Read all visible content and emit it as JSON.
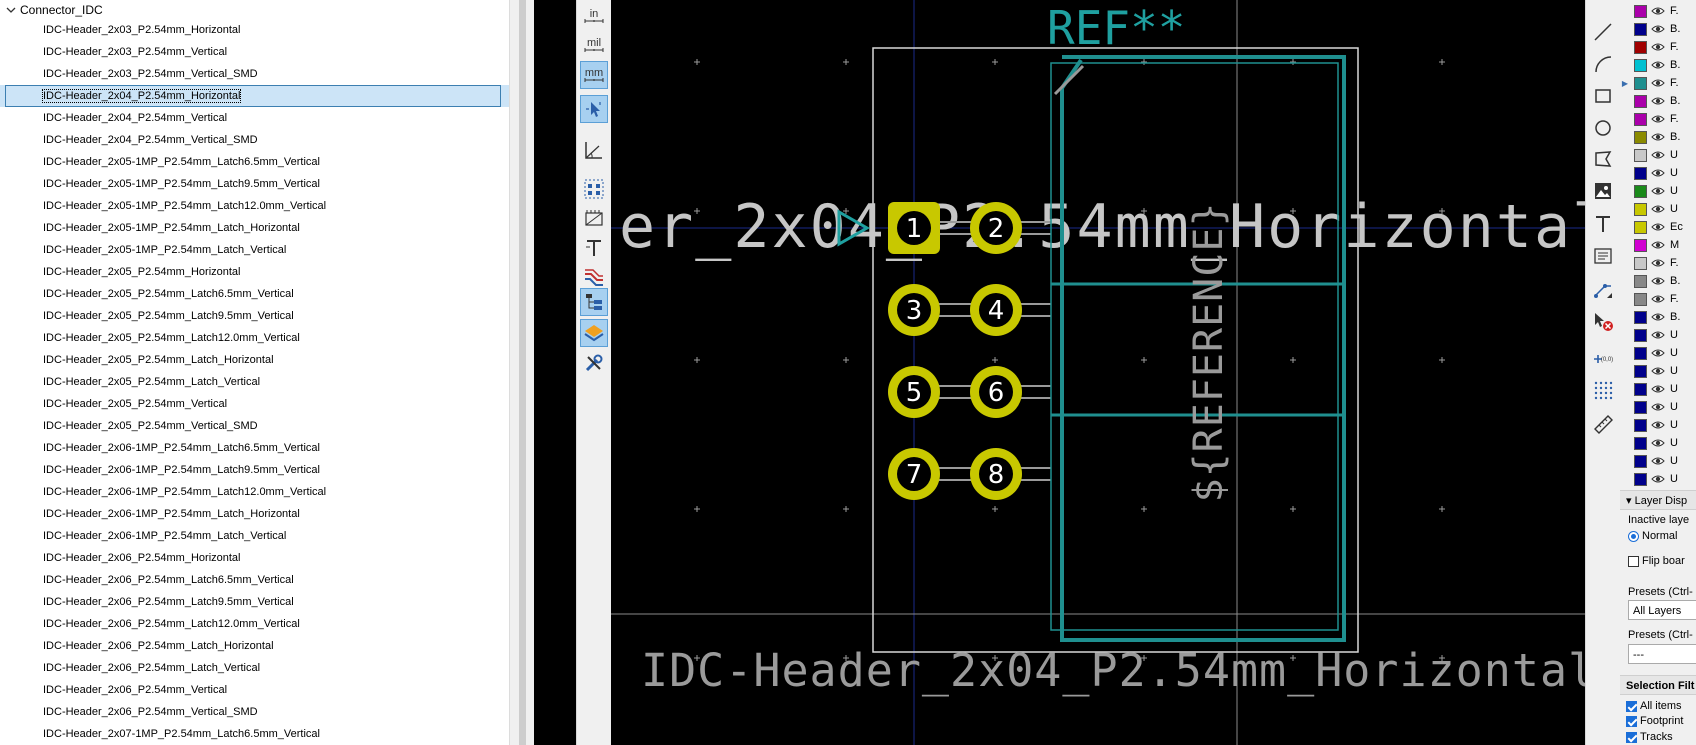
{
  "tree": {
    "root_label": "Connector_IDC",
    "selected_index": 3,
    "items": [
      "IDC-Header_2x03_P2.54mm_Horizontal",
      "IDC-Header_2x03_P2.54mm_Vertical",
      "IDC-Header_2x03_P2.54mm_Vertical_SMD",
      "IDC-Header_2x04_P2.54mm_Horizontal",
      "IDC-Header_2x04_P2.54mm_Vertical",
      "IDC-Header_2x04_P2.54mm_Vertical_SMD",
      "IDC-Header_2x05-1MP_P2.54mm_Latch6.5mm_Vertical",
      "IDC-Header_2x05-1MP_P2.54mm_Latch9.5mm_Vertical",
      "IDC-Header_2x05-1MP_P2.54mm_Latch12.0mm_Vertical",
      "IDC-Header_2x05-1MP_P2.54mm_Latch_Horizontal",
      "IDC-Header_2x05-1MP_P2.54mm_Latch_Vertical",
      "IDC-Header_2x05_P2.54mm_Horizontal",
      "IDC-Header_2x05_P2.54mm_Latch6.5mm_Vertical",
      "IDC-Header_2x05_P2.54mm_Latch9.5mm_Vertical",
      "IDC-Header_2x05_P2.54mm_Latch12.0mm_Vertical",
      "IDC-Header_2x05_P2.54mm_Latch_Horizontal",
      "IDC-Header_2x05_P2.54mm_Latch_Vertical",
      "IDC-Header_2x05_P2.54mm_Vertical",
      "IDC-Header_2x05_P2.54mm_Vertical_SMD",
      "IDC-Header_2x06-1MP_P2.54mm_Latch6.5mm_Vertical",
      "IDC-Header_2x06-1MP_P2.54mm_Latch9.5mm_Vertical",
      "IDC-Header_2x06-1MP_P2.54mm_Latch12.0mm_Vertical",
      "IDC-Header_2x06-1MP_P2.54mm_Latch_Horizontal",
      "IDC-Header_2x06-1MP_P2.54mm_Latch_Vertical",
      "IDC-Header_2x06_P2.54mm_Horizontal",
      "IDC-Header_2x06_P2.54mm_Latch6.5mm_Vertical",
      "IDC-Header_2x06_P2.54mm_Latch9.5mm_Vertical",
      "IDC-Header_2x06_P2.54mm_Latch12.0mm_Vertical",
      "IDC-Header_2x06_P2.54mm_Latch_Horizontal",
      "IDC-Header_2x06_P2.54mm_Latch_Vertical",
      "IDC-Header_2x06_P2.54mm_Vertical",
      "IDC-Header_2x06_P2.54mm_Vertical_SMD",
      "IDC-Header_2x07-1MP_P2.54mm_Latch6.5mm_Vertical"
    ]
  },
  "left_toolbar": {
    "unit_in": "in",
    "unit_mil": "mil",
    "unit_mm": "mm",
    "icons": [
      "cursor-snap-icon",
      "polar-coords-icon",
      "show-pads-icon",
      "show-graphics-icon",
      "show-text-icon",
      "show-tracks-icon",
      "layer-manager-icon",
      "appearance-icon",
      "tools-icon"
    ]
  },
  "canvas": {
    "ref_text": "REF**",
    "value_text_partial": "er_2x04_P2.54mm_Horizontal",
    "reference_field": "${REFERENCE}",
    "footprint_name": "IDC-Header_2x04_P2.54mm_Horizontal",
    "pin_numbers": [
      "1",
      "2",
      "3",
      "4",
      "5",
      "6",
      "7",
      "8"
    ],
    "colors": {
      "pad": "#c8c800",
      "courtyard": "#d8d8d8",
      "fab": "#1f8f8f",
      "value_text": "#c6c6c6",
      "ref_text": "#1fa0a0",
      "fab_text": "#9a9a9a"
    }
  },
  "right_toolbar": {
    "icons": [
      "line-icon",
      "arc-icon",
      "rectangle-icon",
      "circle-icon",
      "polygon-icon",
      "image-icon",
      "text-icon",
      "textbox-icon",
      "dimension-icon",
      "delete-icon",
      "anchor-icon",
      "grid-origin-icon",
      "measure-icon"
    ],
    "anchor_label": "(0,0)"
  },
  "layers": [
    {
      "color": "#aa00aa",
      "label": "F."
    },
    {
      "color": "#00008b",
      "label": "B."
    },
    {
      "color": "#a00000",
      "label": "F."
    },
    {
      "color": "#00c0d0",
      "label": "B."
    },
    {
      "color": "#1f8f8f",
      "label": "F.",
      "active": true
    },
    {
      "color": "#aa00aa",
      "label": "B."
    },
    {
      "color": "#aa00aa",
      "label": "F."
    },
    {
      "color": "#8a8a00",
      "label": "B."
    },
    {
      "color": "#c8c8c8",
      "label": "U"
    },
    {
      "color": "#00008b",
      "label": "U"
    },
    {
      "color": "#1a8a1a",
      "label": "U"
    },
    {
      "color": "#c8c800",
      "label": "U"
    },
    {
      "color": "#c8c800",
      "label": "Ec"
    },
    {
      "color": "#d000d0",
      "label": "M"
    },
    {
      "color": "#c8c8c8",
      "label": "F."
    },
    {
      "color": "#888888",
      "label": "B."
    },
    {
      "color": "#888888",
      "label": "F."
    },
    {
      "color": "#00008b",
      "label": "B."
    },
    {
      "color": "#00008b",
      "label": "U"
    },
    {
      "color": "#00008b",
      "label": "U"
    },
    {
      "color": "#00008b",
      "label": "U"
    },
    {
      "color": "#00008b",
      "label": "U"
    },
    {
      "color": "#00008b",
      "label": "U"
    },
    {
      "color": "#00008b",
      "label": "U"
    },
    {
      "color": "#00008b",
      "label": "U"
    },
    {
      "color": "#00008b",
      "label": "U"
    },
    {
      "color": "#00008b",
      "label": "U"
    }
  ],
  "appearance": {
    "layer_display_header": "Layer Disp",
    "inactive_label": "Inactive laye",
    "inactive_mode": "Normal",
    "flip_board_label": "Flip boar",
    "presets_label_1": "Presets (Ctrl-",
    "presets_value_1": "All Layers",
    "presets_label_2": "Presets (Ctrl-",
    "presets_value_2": "---",
    "selection_filter_header": "Selection Filt",
    "filter_all_items": "All items",
    "filter_footprints": "Footprint",
    "filter_tracks": "Tracks"
  }
}
